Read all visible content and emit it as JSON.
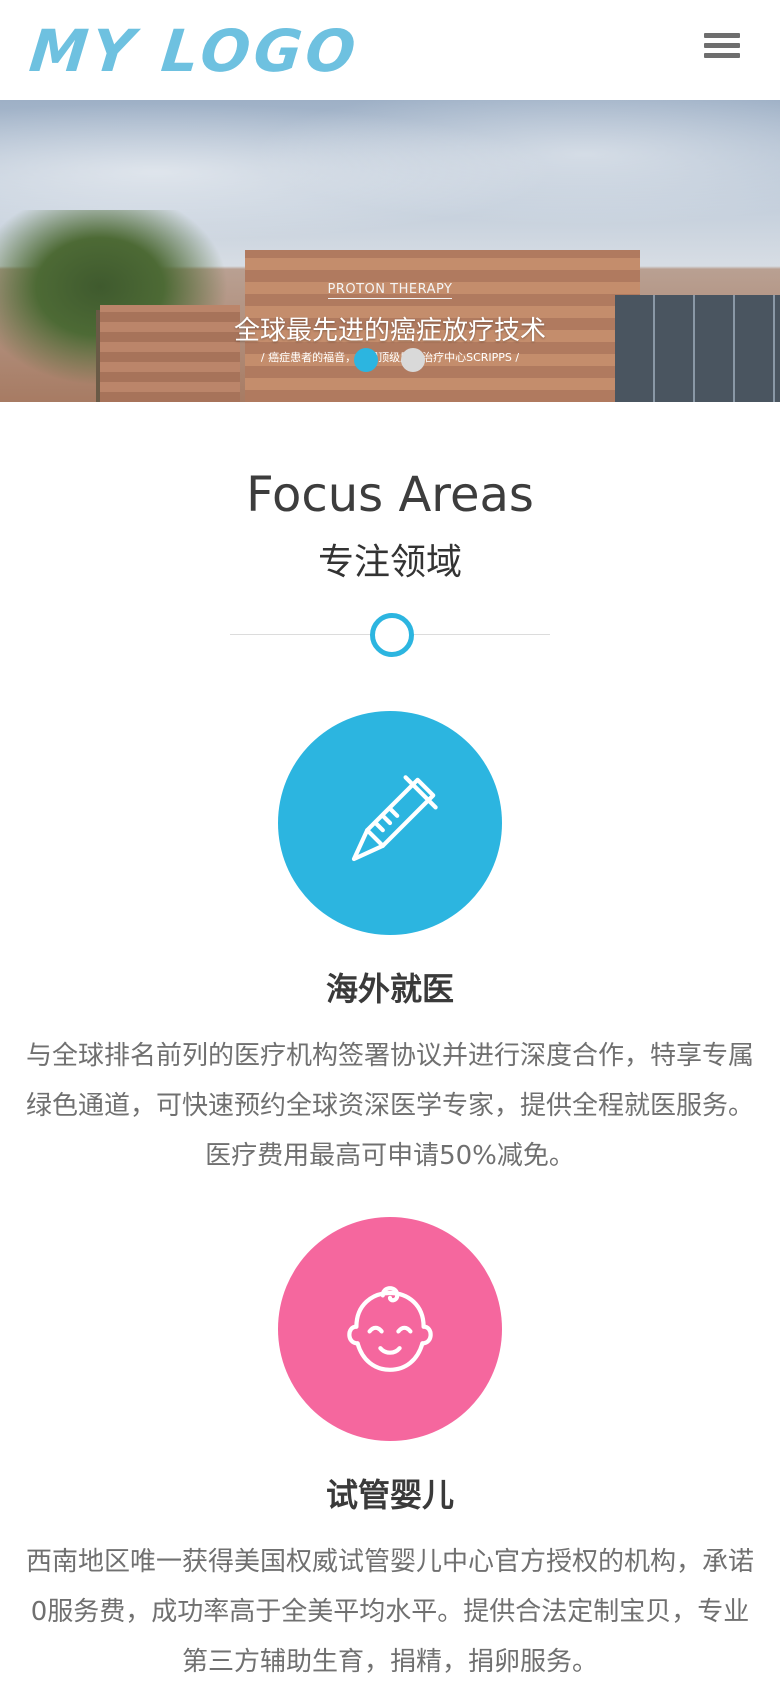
{
  "header": {
    "logo_text": "MY LOGO",
    "menu_icon": "hamburger-menu-icon"
  },
  "banner": {
    "eyebrow": "PROTON THERAPY",
    "title": "全球最先进的癌症放疗技术",
    "subtitle": "/ 癌症患者的福音，美国顶级质子治疗中心SCRIPPS /",
    "slides_total": 2,
    "active_slide": 1
  },
  "focus": {
    "title": "Focus Areas",
    "subtitle": "专注领域"
  },
  "features": [
    {
      "icon": "thermometer-icon",
      "color": "#2cb5e0",
      "title": "海外就医",
      "text": "与全球排名前列的医疗机构签署协议并进行深度合作，特享专属绿色通道，可快速预约全球资深医学专家，提供全程就医服务。医疗费用最高可申请50%减免。"
    },
    {
      "icon": "baby-face-icon",
      "color": "#f5679e",
      "title": "试管婴儿",
      "text": "西南地区唯一获得美国权威试管婴儿中心官方授权的机构，承诺0服务费，成功率高于全美平均水平。提供合法定制宝贝，专业第三方辅助生育，捐精，捐卵服务。"
    }
  ],
  "colors": {
    "accent": "#2cb5e0",
    "pink": "#f5679e",
    "logo": "#6ec1e0"
  }
}
